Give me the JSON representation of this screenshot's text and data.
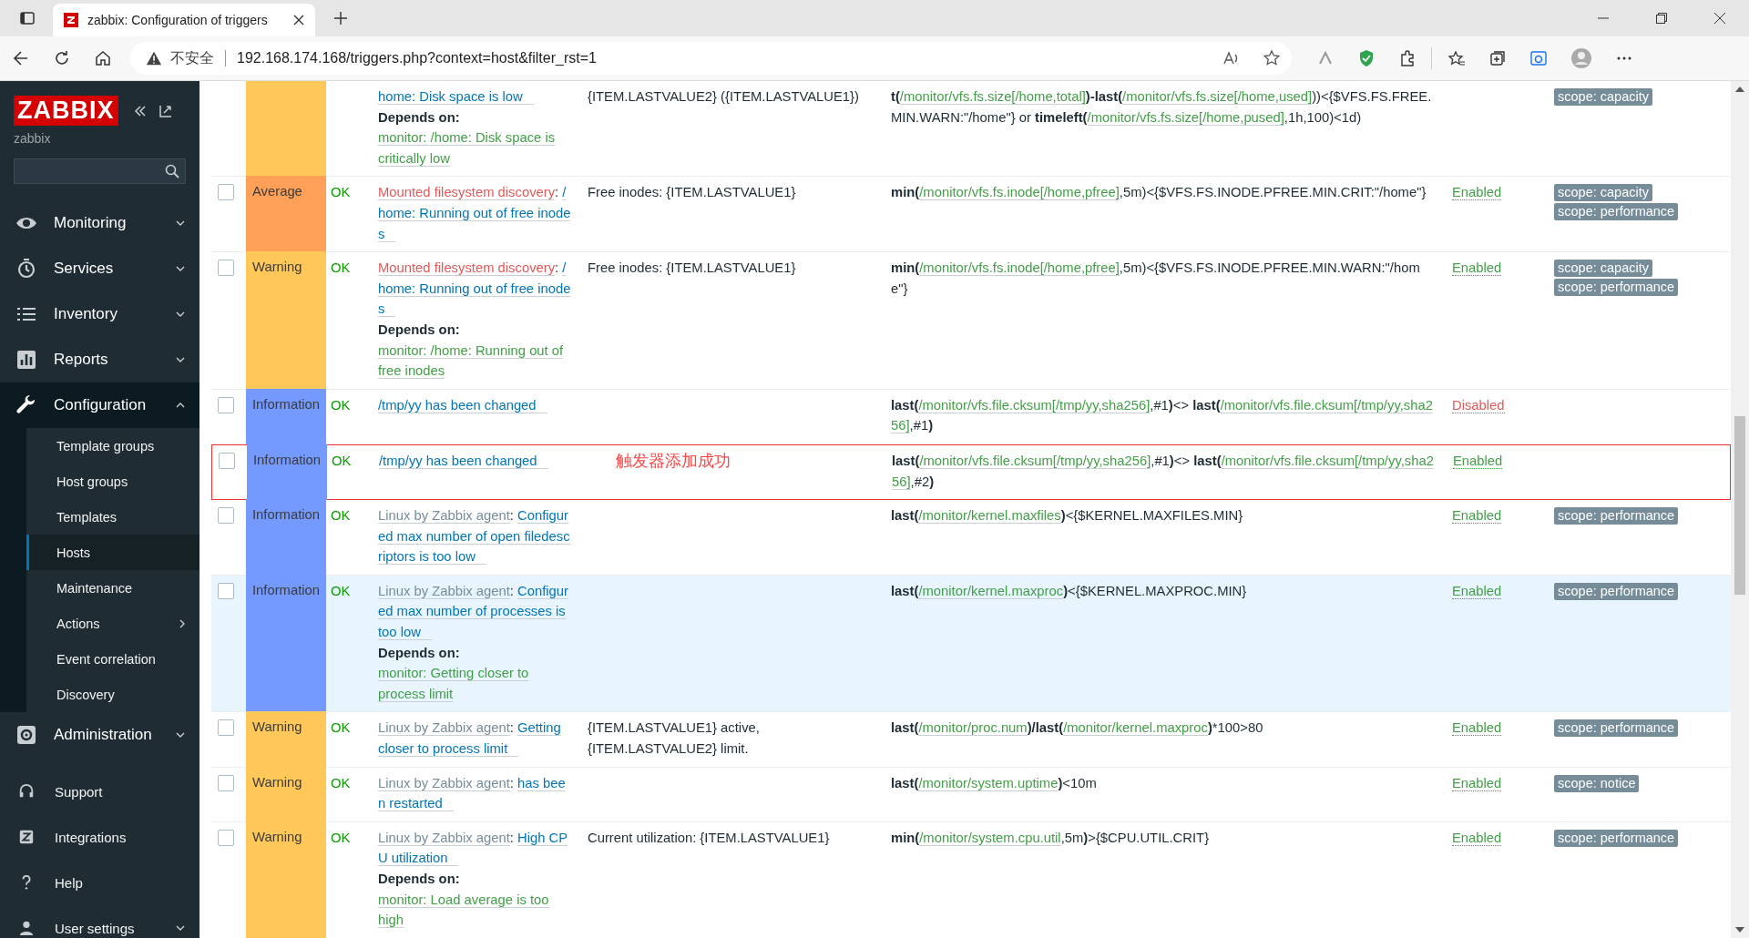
{
  "browser": {
    "tab_title": "zabbix: Configuration of triggers",
    "security": "不安全",
    "url": "192.168.174.168/triggers.php?context=host&filter_rst=1"
  },
  "sidebar": {
    "logo": "ZABBIX",
    "server": "zabbix",
    "menu": [
      {
        "label": "Monitoring",
        "expanded": false
      },
      {
        "label": "Services",
        "expanded": false
      },
      {
        "label": "Inventory",
        "expanded": false
      },
      {
        "label": "Reports",
        "expanded": false
      },
      {
        "label": "Configuration",
        "expanded": true,
        "children": [
          {
            "label": "Template groups",
            "selected": false,
            "submenu": false
          },
          {
            "label": "Host groups",
            "selected": false,
            "submenu": false
          },
          {
            "label": "Templates",
            "selected": false,
            "submenu": false
          },
          {
            "label": "Hosts",
            "selected": true,
            "submenu": false
          },
          {
            "label": "Maintenance",
            "selected": false,
            "submenu": false
          },
          {
            "label": "Actions",
            "selected": false,
            "submenu": true
          },
          {
            "label": "Event correlation",
            "selected": false,
            "submenu": false
          },
          {
            "label": "Discovery",
            "selected": false,
            "submenu": false
          }
        ]
      },
      {
        "label": "Administration",
        "expanded": false
      }
    ],
    "bottom": [
      {
        "label": "Support"
      },
      {
        "label": "Integrations"
      },
      {
        "label": "Help"
      },
      {
        "label": "User settings",
        "expanded": false
      }
    ]
  },
  "rows": [
    {
      "severity": {
        "color": "#ffc859"
      },
      "hovered": false,
      "outlined": false,
      "name": [
        {
          "kind": "name",
          "text": "home: Disk space is low"
        }
      ],
      "depends": {
        "label": "Depends on:",
        "links": [
          "monitor: /home: Disk space is critically low"
        ]
      },
      "description": "{ITEM.LASTVALUE2} ({ITEM.LASTVALUE1})",
      "expression": [
        {
          "kind": "fn",
          "text": "t("
        },
        {
          "kind": "item",
          "text": "/monitor/vfs.fs.size[/home,total]"
        },
        {
          "kind": "fn",
          "text": ")-last("
        },
        {
          "kind": "item",
          "text": "/monitor/vfs.fs.size[/home,used]"
        },
        {
          "kind": "text",
          "text": "))<{$VFS.FS.FREE.MIN.WARN:\"/home\"} or "
        },
        {
          "kind": "fn",
          "text": "timeleft("
        },
        {
          "kind": "item",
          "text": "/monitor/vfs.fs.size[/home,pused]"
        },
        {
          "kind": "text",
          "text": ",1h,100)<1d)"
        }
      ],
      "tags": [
        "scope: capacity"
      ]
    },
    {
      "selected": false,
      "severity": {
        "text": "Average",
        "color": "#ffa059"
      },
      "value": "OK",
      "hovered": false,
      "outlined": false,
      "name": [
        {
          "kind": "discovery",
          "text": "Mounted filesystem discovery"
        },
        {
          "kind": "text",
          "text": ": "
        },
        {
          "kind": "name",
          "text": "/home: Running out of free inodes"
        }
      ],
      "description": "Free inodes: {ITEM.LASTVALUE1}",
      "expression": [
        {
          "kind": "fn",
          "text": "min("
        },
        {
          "kind": "item",
          "text": "/monitor/vfs.fs.inode[/home,pfree]"
        },
        {
          "kind": "text",
          "text": ",5m)<{$VFS.FS.INODE.PFREE.MIN.CRIT:\"/home\"}"
        }
      ],
      "status": {
        "text": "Enabled",
        "enabled": true
      },
      "tags": [
        "scope: capacity",
        "scope: performance"
      ]
    },
    {
      "selected": false,
      "severity": {
        "text": "Warning",
        "color": "#ffc859"
      },
      "value": "OK",
      "hovered": false,
      "outlined": false,
      "name": [
        {
          "kind": "discovery",
          "text": "Mounted filesystem discovery"
        },
        {
          "kind": "text",
          "text": ": "
        },
        {
          "kind": "name",
          "text": "/home: Running out of free inodes"
        }
      ],
      "depends": {
        "label": "Depends on:",
        "links": [
          "monitor: /home: Running out of free inodes"
        ]
      },
      "description": "Free inodes: {ITEM.LASTVALUE1}",
      "expression": [
        {
          "kind": "fn",
          "text": "min("
        },
        {
          "kind": "item",
          "text": "/monitor/vfs.fs.inode[/home,pfree]"
        },
        {
          "kind": "text",
          "text": ",5m)<{$VFS.FS.INODE.PFREE.MIN.WARN:\"/home\"}"
        }
      ],
      "status": {
        "text": "Enabled",
        "enabled": true
      },
      "tags": [
        "scope: capacity",
        "scope: performance"
      ]
    },
    {
      "selected": false,
      "severity": {
        "text": "Information",
        "color": "#7499ff"
      },
      "value": "OK",
      "hovered": false,
      "outlined": false,
      "name": [
        {
          "kind": "name",
          "text": "/tmp/yy has been changed"
        }
      ],
      "expression": [
        {
          "kind": "fn",
          "text": "last("
        },
        {
          "kind": "item",
          "text": "/monitor/vfs.file.cksum[/tmp/yy,sha256]"
        },
        {
          "kind": "text",
          "text": ",#1"
        },
        {
          "kind": "fn",
          "text": ")"
        },
        {
          "kind": "text",
          "text": "<> "
        },
        {
          "kind": "fn",
          "text": "last("
        },
        {
          "kind": "item",
          "text": "/monitor/vfs.file.cksum[/tmp/yy,sha256]"
        },
        {
          "kind": "text",
          "text": ",#1"
        },
        {
          "kind": "fn",
          "text": ")"
        }
      ],
      "status": {
        "text": "Disabled",
        "enabled": false
      }
    },
    {
      "selected": false,
      "severity": {
        "text": "Information",
        "color": "#7499ff"
      },
      "value": "OK",
      "hovered": false,
      "outlined": true,
      "annotation": "触发器添加成功",
      "name": [
        {
          "kind": "name",
          "text": "/tmp/yy has been changed"
        }
      ],
      "expression": [
        {
          "kind": "fn",
          "text": "last("
        },
        {
          "kind": "item",
          "text": "/monitor/vfs.file.cksum[/tmp/yy,sha256]"
        },
        {
          "kind": "text",
          "text": ",#1"
        },
        {
          "kind": "fn",
          "text": ")"
        },
        {
          "kind": "text",
          "text": "<> "
        },
        {
          "kind": "fn",
          "text": "last("
        },
        {
          "kind": "item",
          "text": "/monitor/vfs.file.cksum[/tmp/yy,sha256]"
        },
        {
          "kind": "text",
          "text": ",#2"
        },
        {
          "kind": "fn",
          "text": ")"
        }
      ],
      "status": {
        "text": "Enabled",
        "enabled": true
      }
    },
    {
      "selected": false,
      "severity": {
        "text": "Information",
        "color": "#7499ff"
      },
      "value": "OK",
      "hovered": false,
      "outlined": false,
      "name": [
        {
          "kind": "template",
          "text": "Linux by Zabbix agent"
        },
        {
          "kind": "text",
          "text": ": "
        },
        {
          "kind": "name",
          "text": "Configured max number of open filedescriptors is too low"
        }
      ],
      "expression": [
        {
          "kind": "fn",
          "text": "last("
        },
        {
          "kind": "item",
          "text": "/monitor/kernel.maxfiles"
        },
        {
          "kind": "fn",
          "text": ")"
        },
        {
          "kind": "text",
          "text": "<{$KERNEL.MAXFILES.MIN}"
        }
      ],
      "status": {
        "text": "Enabled",
        "enabled": true
      },
      "tags": [
        "scope: performance"
      ]
    },
    {
      "selected": false,
      "severity": {
        "text": "Information",
        "color": "#7499ff"
      },
      "value": "OK",
      "hovered": true,
      "outlined": false,
      "name": [
        {
          "kind": "template",
          "text": "Linux by Zabbix agent"
        },
        {
          "kind": "text",
          "text": ": "
        },
        {
          "kind": "name",
          "text": "Configured max number of processes is too low"
        }
      ],
      "depends": {
        "label": "Depends on:",
        "links": [
          "monitor: Getting closer to process limit"
        ]
      },
      "expression": [
        {
          "kind": "fn",
          "text": "last("
        },
        {
          "kind": "item",
          "text": "/monitor/kernel.maxproc"
        },
        {
          "kind": "fn",
          "text": ")"
        },
        {
          "kind": "text",
          "text": "<{$KERNEL.MAXPROC.MIN}"
        }
      ],
      "status": {
        "text": "Enabled",
        "enabled": true
      },
      "tags": [
        "scope: performance"
      ]
    },
    {
      "selected": false,
      "severity": {
        "text": "Warning",
        "color": "#ffc859"
      },
      "value": "OK",
      "hovered": false,
      "outlined": false,
      "name": [
        {
          "kind": "template",
          "text": "Linux by Zabbix agent"
        },
        {
          "kind": "text",
          "text": ": "
        },
        {
          "kind": "name",
          "text": "Getting closer to process limit"
        }
      ],
      "description": "{ITEM.LASTVALUE1} active, {ITEM.LASTVALUE2} limit.",
      "expression": [
        {
          "kind": "fn",
          "text": "last("
        },
        {
          "kind": "item",
          "text": "/monitor/proc.num"
        },
        {
          "kind": "fn",
          "text": ")/last("
        },
        {
          "kind": "item",
          "text": "/monitor/kernel.maxproc"
        },
        {
          "kind": "fn",
          "text": ")"
        },
        {
          "kind": "text",
          "text": "*100>80"
        }
      ],
      "status": {
        "text": "Enabled",
        "enabled": true
      },
      "tags": [
        "scope: performance"
      ]
    },
    {
      "selected": false,
      "severity": {
        "text": "Warning",
        "color": "#ffc859"
      },
      "value": "OK",
      "hovered": false,
      "outlined": false,
      "name": [
        {
          "kind": "template",
          "text": "Linux by Zabbix agent"
        },
        {
          "kind": "text",
          "text": ": "
        },
        {
          "kind": "name",
          "text": "has been restarted"
        }
      ],
      "expression": [
        {
          "kind": "fn",
          "text": "last("
        },
        {
          "kind": "item",
          "text": "/monitor/system.uptime"
        },
        {
          "kind": "fn",
          "text": ")"
        },
        {
          "kind": "text",
          "text": "<10m"
        }
      ],
      "status": {
        "text": "Enabled",
        "enabled": true
      },
      "tags": [
        "scope: notice"
      ]
    },
    {
      "selected": false,
      "severity": {
        "text": "Warning",
        "color": "#ffc859"
      },
      "value": "OK",
      "hovered": false,
      "outlined": false,
      "name": [
        {
          "kind": "template",
          "text": "Linux by Zabbix agent"
        },
        {
          "kind": "text",
          "text": ": "
        },
        {
          "kind": "name",
          "text": "High CPU utilization"
        }
      ],
      "depends": {
        "label": "Depends on:",
        "links": [
          "monitor: Load average is too high"
        ]
      },
      "description": "Current utilization: {ITEM.LASTVALUE1}",
      "expression": [
        {
          "kind": "fn",
          "text": "min("
        },
        {
          "kind": "item",
          "text": "/monitor/system.cpu.util"
        },
        {
          "kind": "text",
          "text": ",5m"
        },
        {
          "kind": "fn",
          "text": ")"
        },
        {
          "kind": "text",
          "text": ">{$CPU.UTIL.CRIT}"
        }
      ],
      "status": {
        "text": "Enabled",
        "enabled": true
      },
      "tags": [
        "scope: performance"
      ]
    }
  ]
}
